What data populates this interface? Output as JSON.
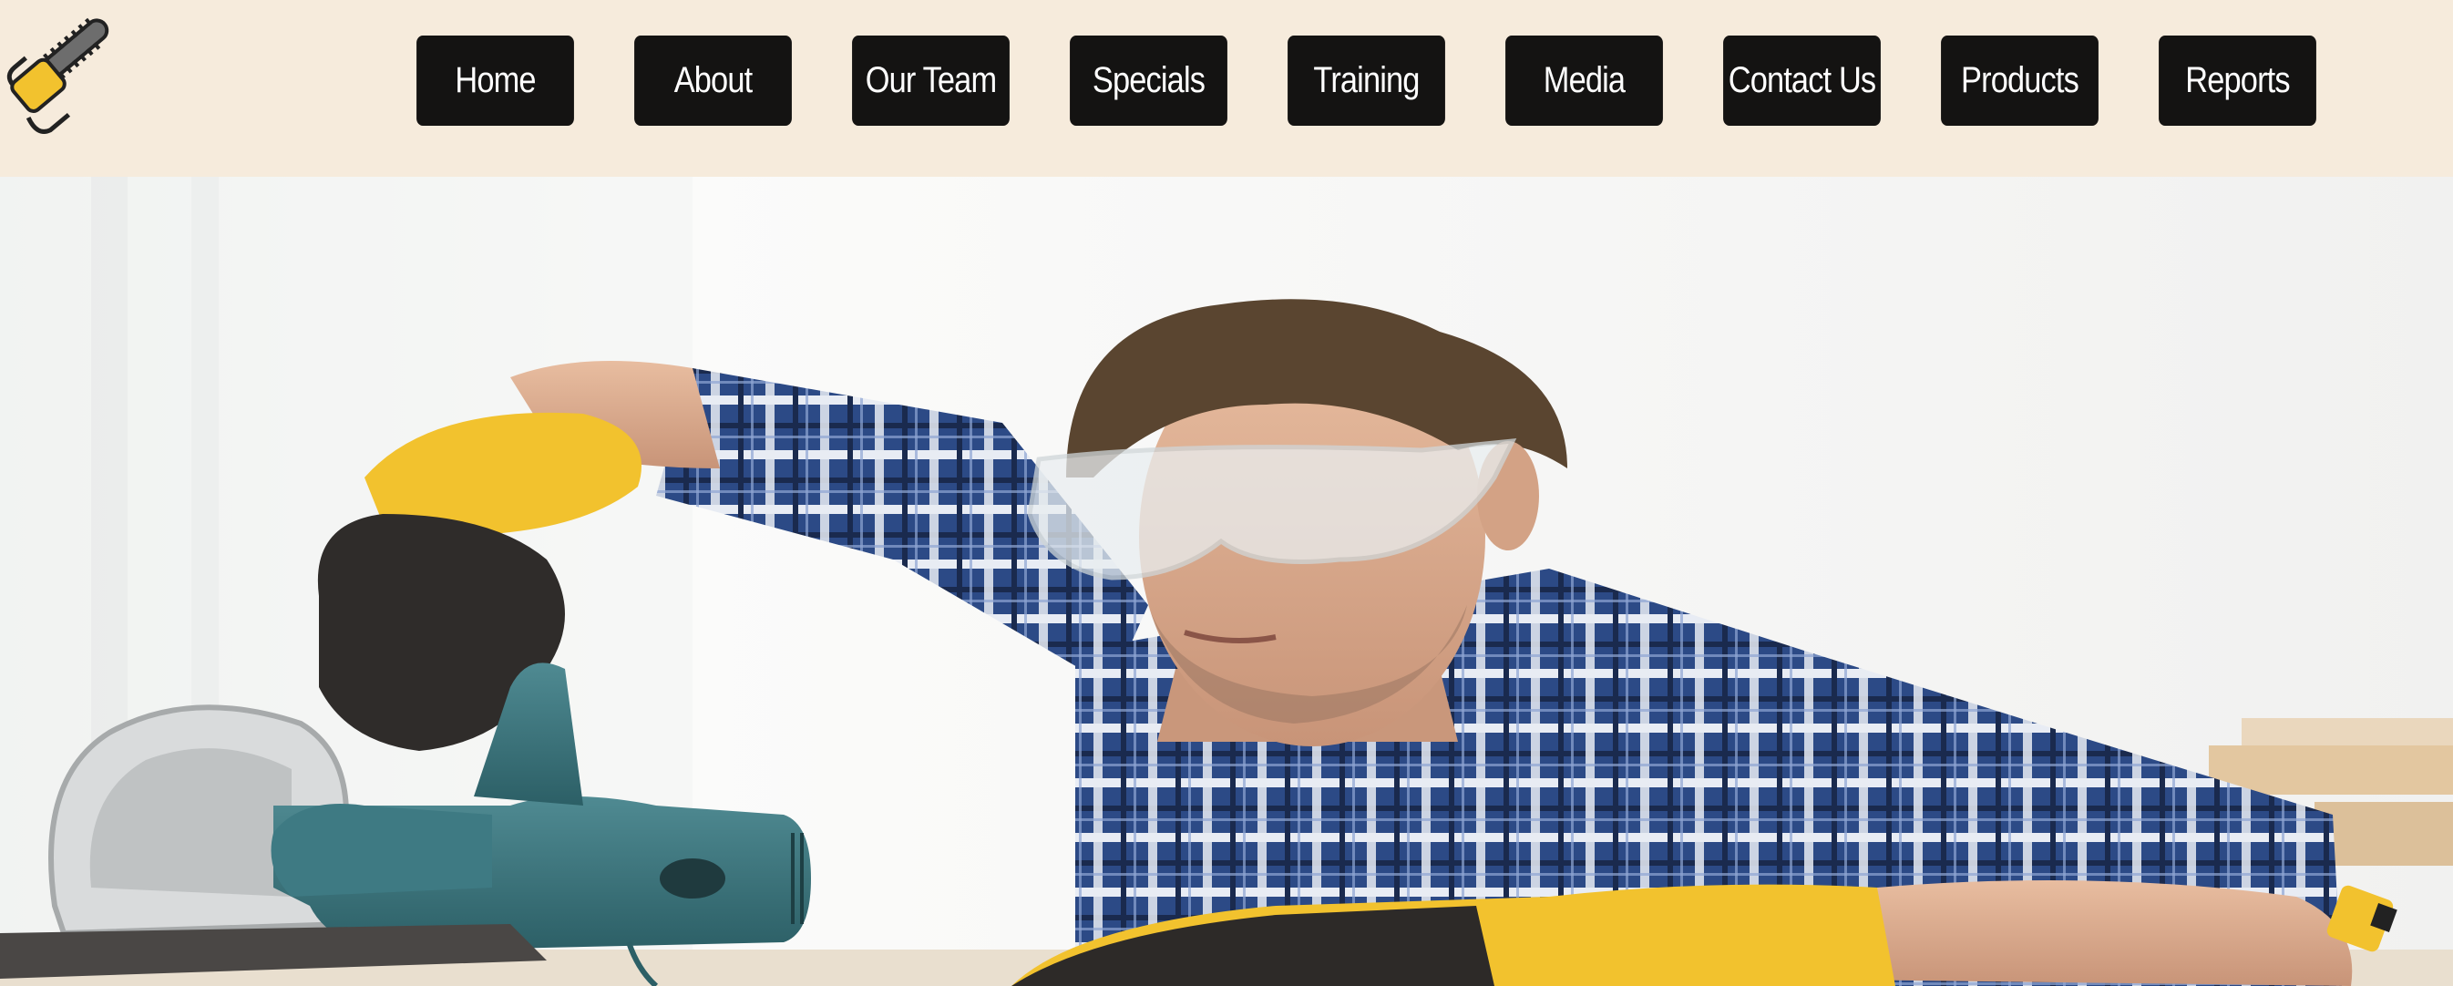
{
  "brand": {
    "logo_icon": "chainsaw-icon",
    "accent": "#f2c22e",
    "header_bg": "#f6ebdc",
    "button_bg": "#141312"
  },
  "nav": {
    "items": [
      {
        "label": "Home"
      },
      {
        "label": "About"
      },
      {
        "label": "Our Team"
      },
      {
        "label": "Specials"
      },
      {
        "label": "Training"
      },
      {
        "label": "Media"
      },
      {
        "label": "Contact Us"
      },
      {
        "label": "Products"
      },
      {
        "label": "Reports"
      }
    ]
  },
  "hero": {
    "image": "worker-cutting-with-circular-saw"
  }
}
